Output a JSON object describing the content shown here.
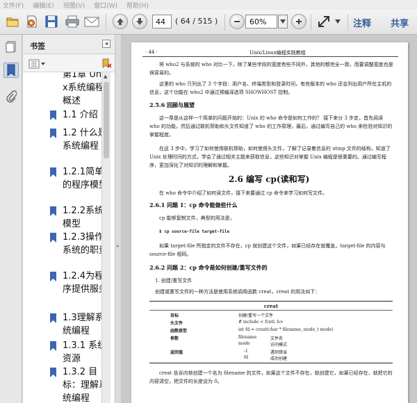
{
  "menu": [
    "文件(F)",
    "编辑(E)",
    "视图(V)",
    "窗口(W)",
    "帮助(H)"
  ],
  "toolbar": {
    "page_number": "44",
    "page_count": "( 64 / 515 )",
    "zoom": "60%",
    "annotate_label": "注释",
    "share_label": "共享"
  },
  "sidebar": {
    "title": "书签",
    "collapse_glyph": "◂",
    "bookmarks": [
      {
        "label": "第1章 Unix系统编程概述"
      },
      {
        "label": "1.1 介绍"
      },
      {
        "label": "1.2 什么是系统编程"
      },
      {
        "label": "1.2.1简单的程序模型"
      },
      {
        "label": "1.2.2系统模型"
      },
      {
        "label": "1.2.3操作系统的职责"
      },
      {
        "label": "1.2.4为程序提供服务"
      },
      {
        "label": "1.3理解系统编程"
      },
      {
        "label": "1.3.1 系统资源"
      },
      {
        "label": "1.3.2 目标：理解系统编程"
      }
    ]
  },
  "document": {
    "running_head_num": "· 44 ·",
    "running_head_title": "Unix/Linux编程实践教程",
    "para1": "将 who2 与系统的 who 对比一下，除了某些字段的宽度有些不同外，其他的都完全一致，而要调整宽度也是很容易的。",
    "para2": "这里的 who 只列出了 3 个字段：用户名、终端类型和登录时间，有些版本的 who 还会列出用户所在主机的信息，这个功能在 who2 中通过预编译选项 SHOWHOST 控制。",
    "sec_256": "2.5.6  回顾与展望",
    "para3": "这一章是从这样一个简单的问题开始的：Unix 的 who 命令是如何工作的？ 接下来分 3 步走，首先阅读 who 的功能，然后通过联机帮助和头文件知道了 who 的工作原理，最后，通过编写自己的 who 来检验对知识的掌握程度。",
    "para4": "在这 3 步中，学习了如何使用联机帮助，如何使用头文件，了解了记录着信息的 utmp 文件的结构，知道了 Unix 处理时间的方式，学会了通过相关主题来获取信息，这些知识对掌握 Unix 编程是很重要的。通过编写程序，更加深化了对知识的理解和掌握。",
    "chapter_26": "2.6   编写 cp(读和写)",
    "para5": "在 who 命令中介绍了如何读文件，接下来要通过 cp 命令来学习如何写文件。",
    "sec_261": "2.6.1   问题 1：cp 命令能做些什么",
    "para6": "cp 能够复制文件，典型的用法是，",
    "cmd": "$ cp source-file target-file",
    "para7": "如果 target-file 所指定的文件不存在，cp 就创建这个文件，如果已经存在就覆盖，target-file 的内容与 source-file 相同。",
    "sec_262": "2.6.2   问题 2：cp 命令是如何创建/重写文件的",
    "sub1": "1. 创建/重写文件",
    "para8": "创建或重写文件的一种方法是使用系统调用函数 creat，creat 的用法如下：",
    "table": {
      "title": "creat",
      "rows": [
        {
          "k": "目标",
          "v": "创建/重写一个文件",
          "v2": ""
        },
        {
          "k": "头文件",
          "v": "# include < fcntl. h>",
          "v2": ""
        },
        {
          "k": "函数原型",
          "v": "int fd = creat(char * filename, mode_t mode)",
          "v2": ""
        },
        {
          "k": "参数",
          "v": "filename",
          "v2": "文件名"
        },
        {
          "k": "",
          "v": "mode",
          "v2": "访问模式"
        },
        {
          "k": "返回值",
          "v": "-1",
          "v2": "遇到错误"
        },
        {
          "k": "",
          "v": "fd",
          "v2": "成功创建"
        }
      ]
    },
    "para9": "creat 告诉内核创建一个名为 filename 的文件，如果这个文件不存在，就创建它，如果已经存在，就把它的内容清空，把文件的长度设为 0。"
  }
}
